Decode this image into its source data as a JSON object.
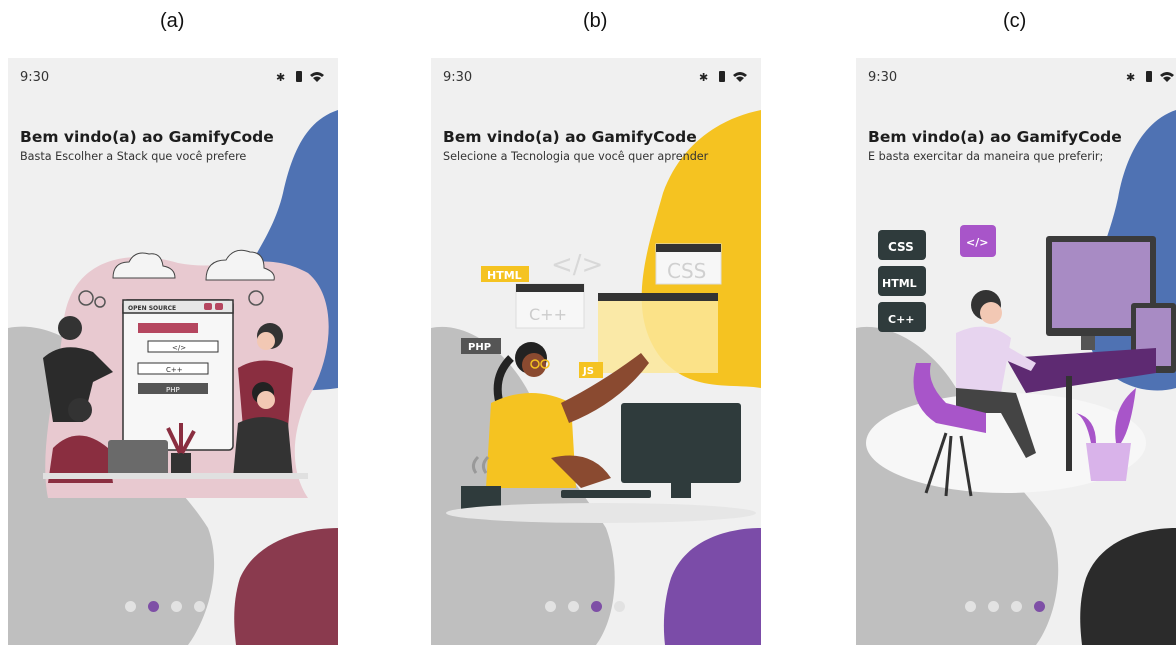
{
  "panels": [
    {
      "label": "(a)",
      "status_time": "9:30",
      "title": "Bem vindo(a) ao GamifyCode",
      "subtitle": "Basta Escolher a Stack que você prefere",
      "illustration_text": {
        "sign": "OPEN SOURCE",
        "tag1": "</>",
        "tag2": "C++",
        "tag3": "PHP"
      },
      "active_dot": 1,
      "colors": {
        "top_blob": "#4f72b3",
        "bottom_blob": "#8a3a4e",
        "back_blob": "#e8c9d0"
      }
    },
    {
      "label": "(b)",
      "status_time": "9:30",
      "title": "Bem vindo(a) ao GamifyCode",
      "subtitle": "Selecione a Tecnologia que você quer aprender",
      "illustration_text": {
        "html": "HTML",
        "cpp": "C++",
        "css": "CSS",
        "php": "PHP",
        "js": "JS",
        "code": "</>"
      },
      "active_dot": 2,
      "colors": {
        "top_blob": "#f5c321",
        "bottom_blob": "#7b4ca8"
      }
    },
    {
      "label": "(c)",
      "status_time": "9:30",
      "title": "Bem vindo(a) ao GamifyCode",
      "subtitle": "E basta exercitar da maneira que preferir;",
      "illustration_text": {
        "css": "CSS",
        "html": "HTML",
        "cpp": "C++",
        "code": "</>"
      },
      "active_dot": 3,
      "colors": {
        "top_blob": "#4f72b3",
        "bottom_blob": "#2b2b2b"
      }
    }
  ]
}
